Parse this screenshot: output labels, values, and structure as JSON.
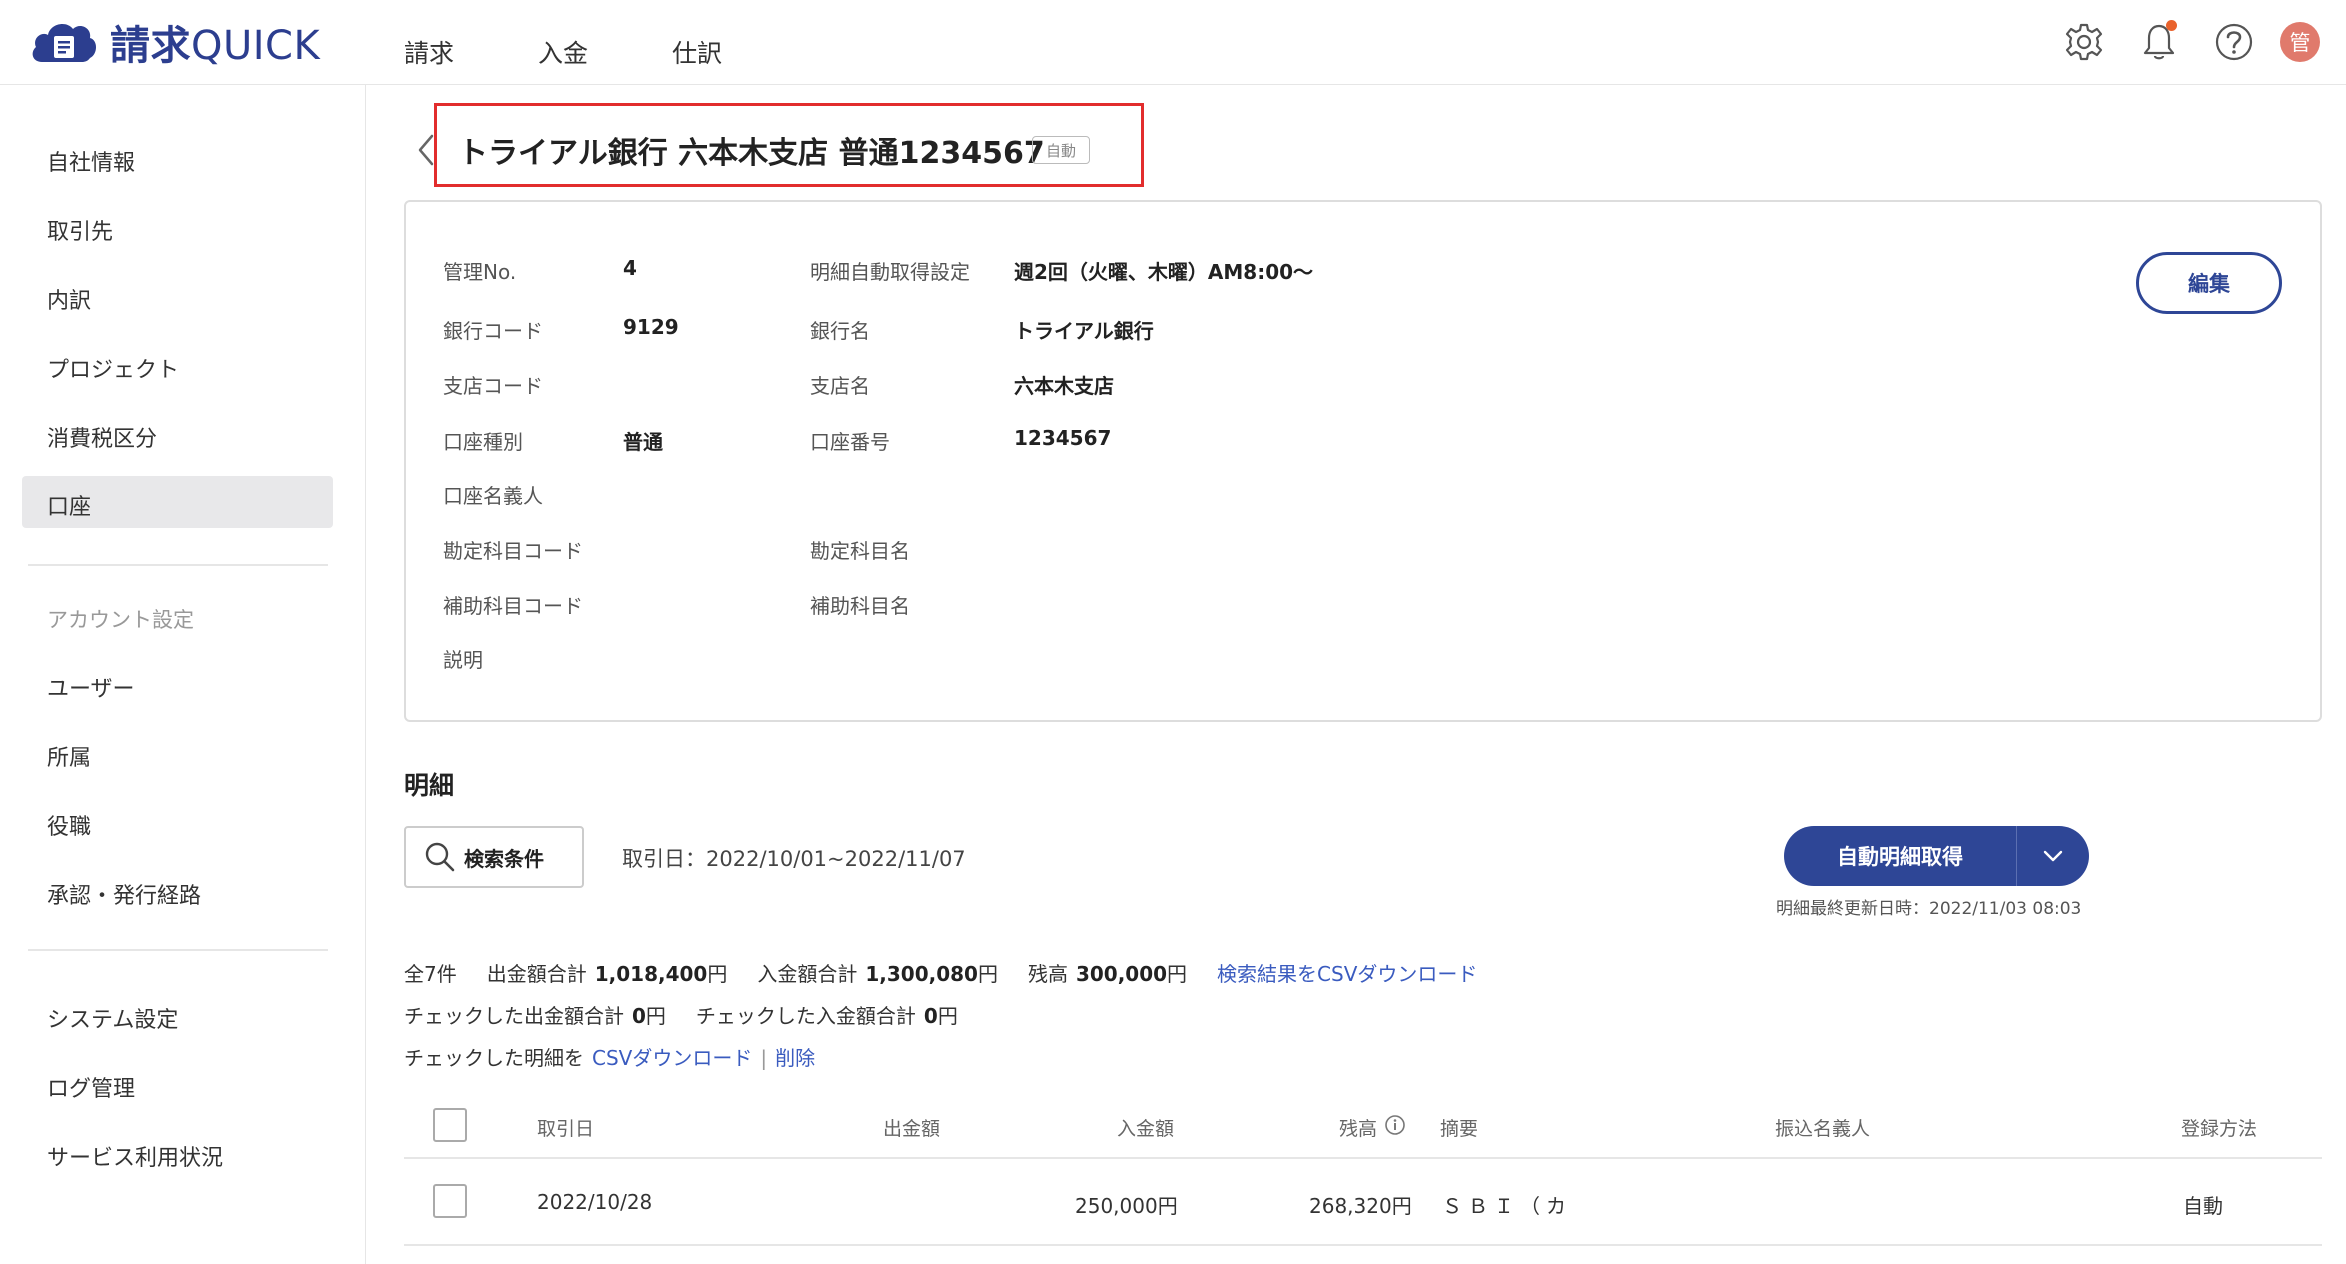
{
  "header": {
    "logo_text_jp": "請求",
    "logo_text_en": "QUICK",
    "nav": [
      "請求",
      "入金",
      "仕訳"
    ],
    "avatar_text": "管"
  },
  "sidebar": {
    "items_top": [
      "自社情報",
      "取引先",
      "内訳",
      "プロジェクト",
      "消費税区分",
      "口座"
    ],
    "active_item": "口座",
    "section_account": "アカウント設定",
    "items_account": [
      "ユーザー",
      "所属",
      "役職",
      "承認・発行経路"
    ],
    "items_bottom": [
      "システム設定",
      "ログ管理",
      "サービス利用状況"
    ]
  },
  "page": {
    "title": "トライアル銀行 六本木支店 普通1234567",
    "badge": "自動"
  },
  "info": {
    "left": [
      {
        "label": "管理No.",
        "value": "4"
      },
      {
        "label": "銀行コード",
        "value": "9129"
      },
      {
        "label": "支店コード",
        "value": ""
      },
      {
        "label": "口座種別",
        "value": "普通"
      },
      {
        "label": "口座名義人",
        "value": ""
      },
      {
        "label": "勘定科目コード",
        "value": ""
      },
      {
        "label": "補助科目コード",
        "value": ""
      },
      {
        "label": "説明",
        "value": ""
      }
    ],
    "right": [
      {
        "label": "明細自動取得設定",
        "value": "週2回（火曜、木曜）AM8:00〜"
      },
      {
        "label": "銀行名",
        "value": "トライアル銀行"
      },
      {
        "label": "支店名",
        "value": "六本木支店"
      },
      {
        "label": "口座番号",
        "value": "1234567"
      },
      {
        "label": "",
        "value": ""
      },
      {
        "label": "勘定科目名",
        "value": ""
      },
      {
        "label": "補助科目名",
        "value": ""
      }
    ],
    "edit_label": "編集"
  },
  "statements": {
    "title": "明細",
    "search_label": "検索条件",
    "date_range": "取引日：2022/10/01~2022/11/07",
    "fetch_label": "自動明細取得",
    "last_updated": "明細最終更新日時：2022/11/03 08:03",
    "summary": {
      "count": "全7件",
      "out_label": "出金額合計",
      "out_value": "1,018,400",
      "in_label": "入金額合計",
      "in_value": "1,300,080",
      "balance_label": "残高",
      "balance_value": "300,000",
      "yen": "円",
      "csv_link": "検索結果をCSVダウンロード",
      "checked_out_label": "チェックした出金額合計",
      "checked_out_value": "0",
      "checked_in_label": "チェックした入金額合計",
      "checked_in_value": "0",
      "checked_prefix": "チェックした明細を",
      "checked_csv": "CSVダウンロード",
      "separator": "|",
      "delete": "削除"
    },
    "columns": [
      "取引日",
      "出金額",
      "入金額",
      "残高",
      "摘要",
      "振込名義人",
      "登録方法"
    ],
    "rows": [
      {
        "date": "2022/10/28",
        "out": "",
        "in": "250,000円",
        "balance": "268,320円",
        "memo": "ＳＢＩ（カ",
        "payer": "",
        "method": "自動"
      }
    ]
  },
  "colors": {
    "primary": "#2e4696",
    "highlight_border": "#e22d2d",
    "avatar": "#e07a6c",
    "notification": "#e9622c",
    "link": "#3a5bbf"
  },
  "icons": [
    "cloud-logo-icon",
    "gear-icon",
    "bell-icon",
    "help-icon",
    "back-arrow-icon",
    "search-icon",
    "chevron-down-icon",
    "info-icon"
  ]
}
